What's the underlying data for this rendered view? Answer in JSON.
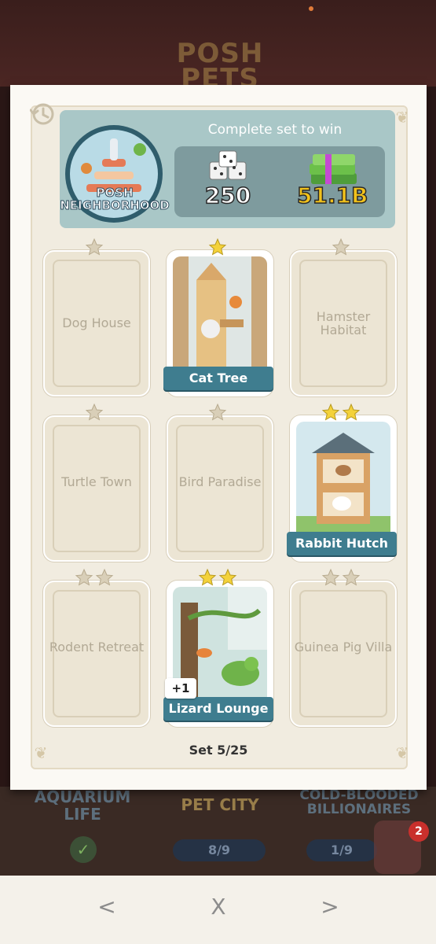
{
  "background": {
    "logo_lines": [
      "POSH",
      "PETS"
    ],
    "sets": [
      {
        "name": "AQUARIUM LIFE",
        "status": "complete"
      },
      {
        "name": "PET CITY",
        "progress": "8/9"
      },
      {
        "name": "COLD-BLOODED BILLIONAIRES",
        "progress": "1/9"
      }
    ],
    "notification_count": "2"
  },
  "header": {
    "title": "Complete set to win",
    "set_badge_line1": "POSH",
    "set_badge_line2": "NEIGHBORHOOD",
    "reward_dice": "250",
    "reward_cash": "51.1B"
  },
  "cards": [
    {
      "name": "Dog House",
      "stars": 1,
      "owned": false
    },
    {
      "name": "Cat Tree",
      "stars": 1,
      "owned": true
    },
    {
      "name": "Hamster Habitat",
      "stars": 1,
      "owned": false
    },
    {
      "name": "Turtle Town",
      "stars": 1,
      "owned": false
    },
    {
      "name": "Bird Paradise",
      "stars": 1,
      "owned": false
    },
    {
      "name": "Rabbit Hutch",
      "stars": 2,
      "owned": true
    },
    {
      "name": "Rodent Retreat",
      "stars": 2,
      "owned": false
    },
    {
      "name": "Lizard Lounge",
      "stars": 2,
      "owned": true,
      "extra": "+1"
    },
    {
      "name": "Guinea Pig Villa",
      "stars": 2,
      "owned": false
    }
  ],
  "footer": {
    "set_count": "Set 5/25"
  },
  "nav": {
    "back": "<",
    "close": "X",
    "forward": ">"
  },
  "colors": {
    "ribbon": "#3f7d8f",
    "header_bg": "#a9c7c7",
    "reward_bg": "#7e9b9e",
    "cash_text": "#f2c21b",
    "star_owned": "#f4d23a",
    "star_empty": "#d9cfb8"
  }
}
